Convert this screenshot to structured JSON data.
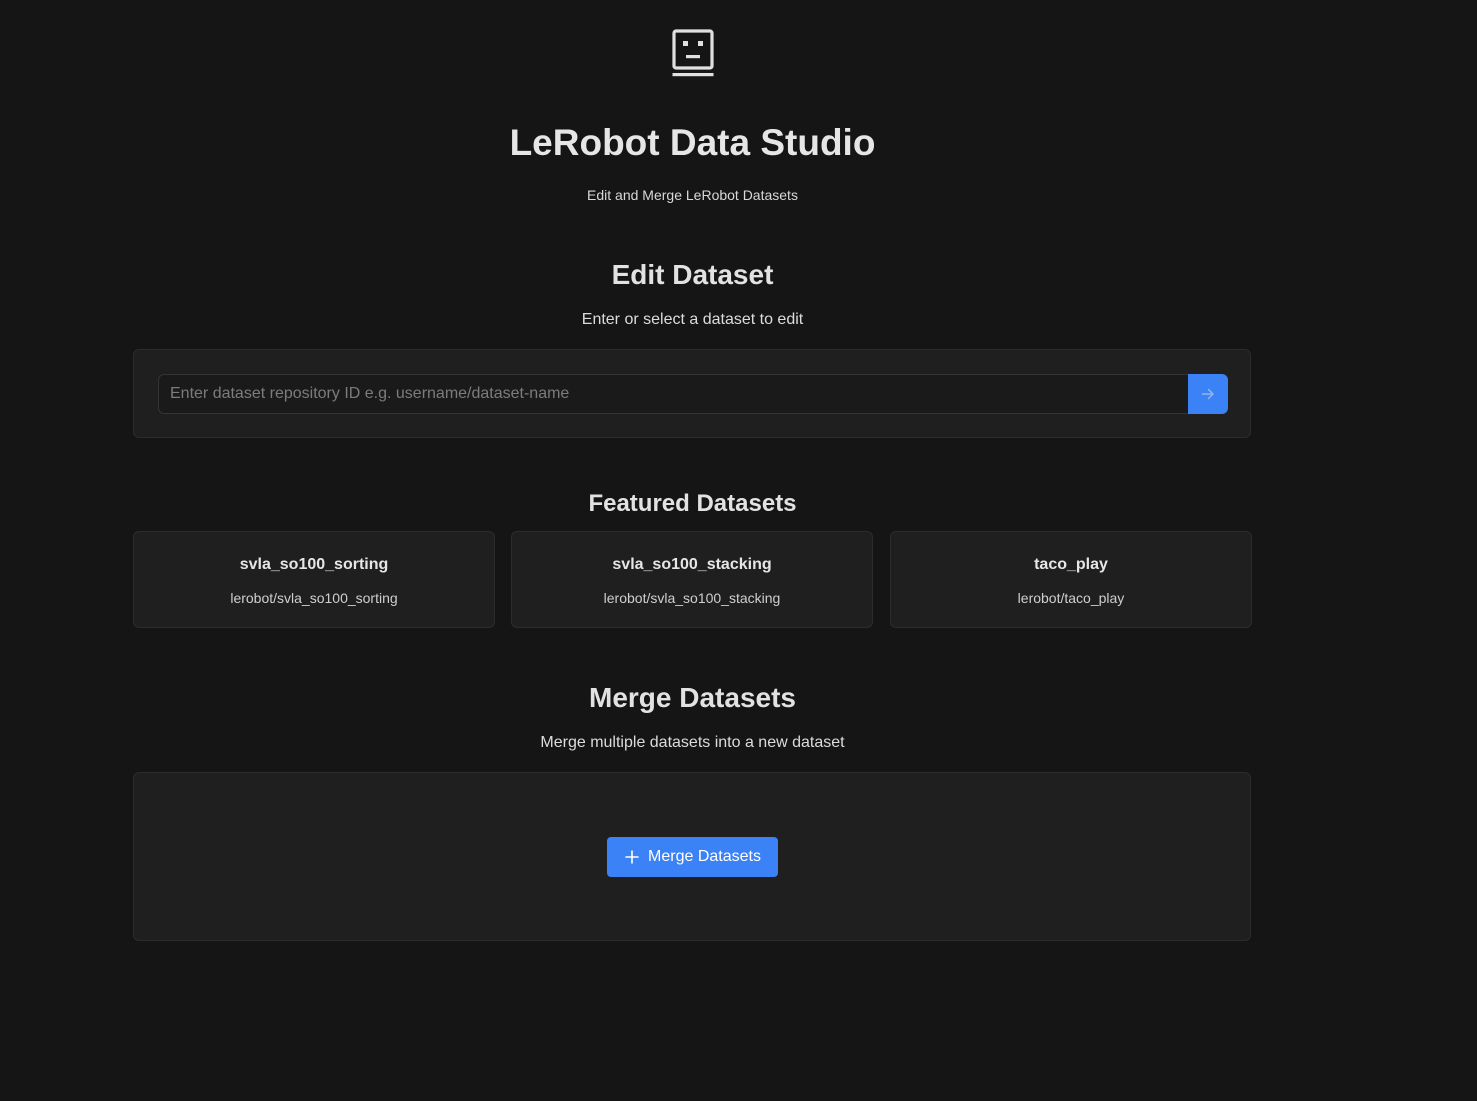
{
  "header": {
    "logo_icon": "robot-face-icon",
    "title": "LeRobot Data Studio",
    "subtitle": "Edit and Merge LeRobot Datasets"
  },
  "edit_section": {
    "title": "Edit Dataset",
    "description": "Enter or select a dataset to edit",
    "search": {
      "placeholder": "Enter dataset repository ID e.g. username/dataset-name",
      "value": "",
      "submit_icon": "arrow-right-icon"
    }
  },
  "featured_section": {
    "title": "Featured Datasets",
    "items": [
      {
        "name": "svla_so100_sorting",
        "repo": "lerobot/svla_so100_sorting"
      },
      {
        "name": "svla_so100_stacking",
        "repo": "lerobot/svla_so100_stacking"
      },
      {
        "name": "taco_play",
        "repo": "lerobot/taco_play"
      }
    ]
  },
  "merge_section": {
    "title": "Merge Datasets",
    "description": "Merge multiple datasets into a new dataset",
    "button_label": "Merge Datasets",
    "button_icon": "plus-icon"
  },
  "colors": {
    "background": "#151515",
    "panel": "#1f1f1f",
    "accent": "#3b82f6"
  }
}
